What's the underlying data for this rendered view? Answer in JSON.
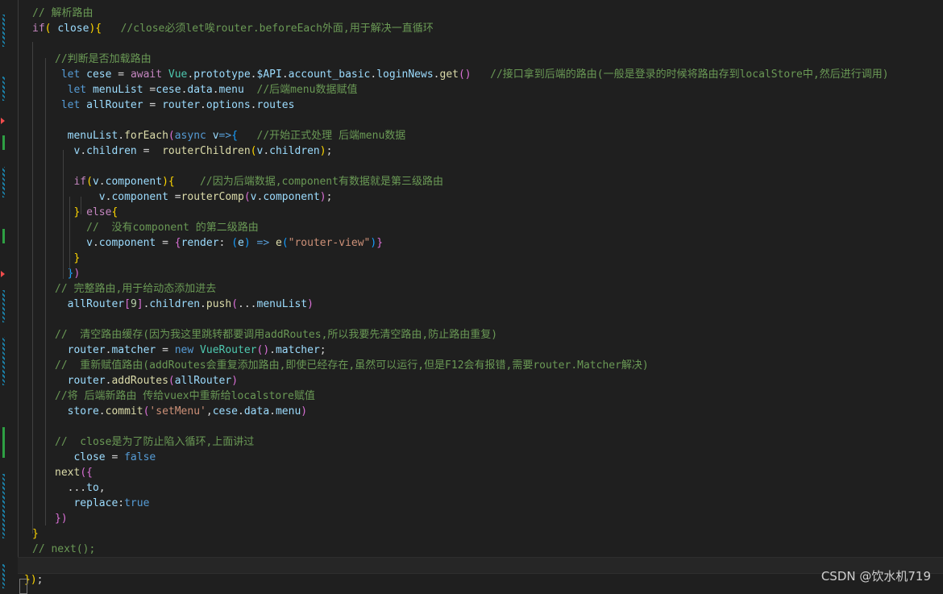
{
  "code_lines": [
    {
      "t": 0,
      "s": [
        [
          "// 解析路由",
          "t-cm"
        ]
      ]
    },
    {
      "t": 0,
      "s": [
        [
          "if",
          "t-ctl"
        ],
        [
          "( ",
          "t-br1"
        ],
        [
          "close",
          "t-var"
        ],
        [
          "){",
          "t-br1"
        ],
        [
          "   //close必须let唉router.beforeEach外面,用于解决一直循环",
          "t-cm"
        ]
      ]
    },
    {
      "t": 0,
      "s": []
    },
    {
      "t": 1,
      "s": [
        [
          "//判断是否加载路由",
          "t-cm"
        ]
      ]
    },
    {
      "t": 1,
      "s": [
        [
          " ",
          "t-pl"
        ],
        [
          "let ",
          "t-kw"
        ],
        [
          "cese",
          "t-var"
        ],
        [
          " = ",
          "t-pl"
        ],
        [
          "await ",
          "t-ctl"
        ],
        [
          "Vue",
          "t-cls"
        ],
        [
          ".",
          "t-pl"
        ],
        [
          "prototype",
          "t-var"
        ],
        [
          ".",
          "t-pl"
        ],
        [
          "$API",
          "t-var"
        ],
        [
          ".",
          "t-pl"
        ],
        [
          "account_basic",
          "t-var"
        ],
        [
          ".",
          "t-pl"
        ],
        [
          "loginNews",
          "t-var"
        ],
        [
          ".",
          "t-pl"
        ],
        [
          "get",
          "t-fn"
        ],
        [
          "()",
          "t-br2"
        ],
        [
          "   //接口拿到后端的路由(一般是登录的时候将路由存到localStore中,然后进行调用)",
          "t-cm"
        ]
      ]
    },
    {
      "t": 1,
      "s": [
        [
          "  let ",
          "t-kw"
        ],
        [
          "menuList",
          "t-var"
        ],
        [
          " =",
          "t-pl"
        ],
        [
          "cese",
          "t-var"
        ],
        [
          ".",
          "t-pl"
        ],
        [
          "data",
          "t-var"
        ],
        [
          ".",
          "t-pl"
        ],
        [
          "menu",
          "t-var"
        ],
        [
          "  //后端menu数据赋值",
          "t-cm"
        ]
      ]
    },
    {
      "t": 1,
      "s": [
        [
          " let ",
          "t-kw"
        ],
        [
          "allRouter",
          "t-var"
        ],
        [
          " = ",
          "t-pl"
        ],
        [
          "router",
          "t-var"
        ],
        [
          ".",
          "t-pl"
        ],
        [
          "options",
          "t-var"
        ],
        [
          ".",
          "t-pl"
        ],
        [
          "routes",
          "t-var"
        ]
      ]
    },
    {
      "t": 1,
      "s": []
    },
    {
      "t": 1,
      "s": [
        [
          "  ",
          "t-pl"
        ],
        [
          "menuList",
          "t-var"
        ],
        [
          ".",
          "t-pl"
        ],
        [
          "forEach",
          "t-fn"
        ],
        [
          "(",
          "t-br2"
        ],
        [
          "async ",
          "t-kw"
        ],
        [
          "v",
          "t-var"
        ],
        [
          "=>",
          "t-kw"
        ],
        [
          "{",
          "t-br3"
        ],
        [
          "   //开始正式处理 后端menu数据",
          "t-cm"
        ]
      ]
    },
    {
      "t": 1,
      "s": [
        [
          "   ",
          "t-pl"
        ],
        [
          "v",
          "t-var"
        ],
        [
          ".",
          "t-pl"
        ],
        [
          "children",
          "t-var"
        ],
        [
          " =  ",
          "t-pl"
        ],
        [
          "routerChildren",
          "t-fn"
        ],
        [
          "(",
          "t-br1"
        ],
        [
          "v",
          "t-var"
        ],
        [
          ".",
          "t-pl"
        ],
        [
          "children",
          "t-var"
        ],
        [
          ")",
          "t-br1"
        ],
        [
          ";",
          "t-pl"
        ]
      ]
    },
    {
      "t": 1,
      "s": []
    },
    {
      "t": 1,
      "s": [
        [
          "   ",
          "t-pl"
        ],
        [
          "if",
          "t-ctl"
        ],
        [
          "(",
          "t-br1"
        ],
        [
          "v",
          "t-var"
        ],
        [
          ".",
          "t-pl"
        ],
        [
          "component",
          "t-var"
        ],
        [
          "){",
          "t-br1"
        ],
        [
          "    //因为后端数据,component有数据就是第三级路由",
          "t-cm"
        ]
      ]
    },
    {
      "t": 1,
      "s": [
        [
          "       ",
          "t-pl"
        ],
        [
          "v",
          "t-var"
        ],
        [
          ".",
          "t-pl"
        ],
        [
          "component",
          "t-var"
        ],
        [
          " =",
          "t-pl"
        ],
        [
          "routerComp",
          "t-fn"
        ],
        [
          "(",
          "t-br2"
        ],
        [
          "v",
          "t-var"
        ],
        [
          ".",
          "t-pl"
        ],
        [
          "component",
          "t-var"
        ],
        [
          ")",
          "t-br2"
        ],
        [
          ";",
          "t-pl"
        ]
      ]
    },
    {
      "t": 1,
      "s": [
        [
          "   ",
          "t-pl"
        ],
        [
          "}",
          "t-br1"
        ],
        [
          " else",
          "t-ctl"
        ],
        [
          "{",
          "t-br1"
        ]
      ]
    },
    {
      "t": 1,
      "s": [
        [
          "     //  没有component 的第二级路由",
          "t-cm"
        ]
      ]
    },
    {
      "t": 1,
      "s": [
        [
          "     ",
          "t-pl"
        ],
        [
          "v",
          "t-var"
        ],
        [
          ".",
          "t-pl"
        ],
        [
          "component",
          "t-var"
        ],
        [
          " = ",
          "t-pl"
        ],
        [
          "{",
          "t-br2"
        ],
        [
          "render",
          "t-var"
        ],
        [
          ": ",
          "t-pl"
        ],
        [
          "(",
          "t-br3"
        ],
        [
          "e",
          "t-var"
        ],
        [
          ")",
          "t-br3"
        ],
        [
          " => ",
          "t-kw"
        ],
        [
          "e",
          "t-fn"
        ],
        [
          "(",
          "t-br3"
        ],
        [
          "\"router-view\"",
          "t-str"
        ],
        [
          ")",
          "t-br3"
        ],
        [
          "}",
          "t-br2"
        ]
      ]
    },
    {
      "t": 1,
      "s": [
        [
          "   ",
          "t-pl"
        ],
        [
          "}",
          "t-br1"
        ]
      ]
    },
    {
      "t": 1,
      "s": [
        [
          "  ",
          "t-pl"
        ],
        [
          "}",
          "t-br3"
        ],
        [
          ")",
          "t-br2"
        ]
      ]
    },
    {
      "t": 1,
      "s": [
        [
          "// 完整路由,用于给动态添加进去",
          "t-cm"
        ]
      ]
    },
    {
      "t": 1,
      "s": [
        [
          "  ",
          "t-pl"
        ],
        [
          "allRouter",
          "t-var"
        ],
        [
          "[",
          "t-br2"
        ],
        [
          "9",
          "t-num"
        ],
        [
          "]",
          "t-br2"
        ],
        [
          ".",
          "t-pl"
        ],
        [
          "children",
          "t-var"
        ],
        [
          ".",
          "t-pl"
        ],
        [
          "push",
          "t-fn"
        ],
        [
          "(",
          "t-br2"
        ],
        [
          "...",
          "t-pl"
        ],
        [
          "menuList",
          "t-var"
        ],
        [
          ")",
          "t-br2"
        ]
      ]
    },
    {
      "t": 1,
      "s": []
    },
    {
      "t": 1,
      "s": [
        [
          "//  清空路由缓存(因为我这里跳转都要调用addRoutes,所以我要先清空路由,防止路由重复)",
          "t-cm"
        ]
      ]
    },
    {
      "t": 1,
      "s": [
        [
          "  ",
          "t-pl"
        ],
        [
          "router",
          "t-var"
        ],
        [
          ".",
          "t-pl"
        ],
        [
          "matcher",
          "t-var"
        ],
        [
          " = ",
          "t-pl"
        ],
        [
          "new ",
          "t-kw"
        ],
        [
          "VueRouter",
          "t-cls"
        ],
        [
          "()",
          "t-br2"
        ],
        [
          ".",
          "t-pl"
        ],
        [
          "matcher",
          "t-var"
        ],
        [
          ";",
          "t-pl"
        ]
      ]
    },
    {
      "t": 1,
      "s": [
        [
          "//  重新赋值路由(addRoutes会重复添加路由,即使已经存在,虽然可以运行,但是F12会有报错,需要router.Matcher解决)",
          "t-cm"
        ]
      ]
    },
    {
      "t": 1,
      "s": [
        [
          "  ",
          "t-pl"
        ],
        [
          "router",
          "t-var"
        ],
        [
          ".",
          "t-pl"
        ],
        [
          "addRoutes",
          "t-fn"
        ],
        [
          "(",
          "t-br2"
        ],
        [
          "allRouter",
          "t-var"
        ],
        [
          ")",
          "t-br2"
        ]
      ]
    },
    {
      "t": 1,
      "s": [
        [
          "//将 后端新路由 传给vuex中重新给localstore赋值",
          "t-cm"
        ]
      ]
    },
    {
      "t": 1,
      "s": [
        [
          "  ",
          "t-pl"
        ],
        [
          "store",
          "t-var"
        ],
        [
          ".",
          "t-pl"
        ],
        [
          "commit",
          "t-fn"
        ],
        [
          "(",
          "t-br2"
        ],
        [
          "'setMenu'",
          "t-str"
        ],
        [
          ",",
          "t-pl"
        ],
        [
          "cese",
          "t-var"
        ],
        [
          ".",
          "t-pl"
        ],
        [
          "data",
          "t-var"
        ],
        [
          ".",
          "t-pl"
        ],
        [
          "menu",
          "t-var"
        ],
        [
          ")",
          "t-br2"
        ]
      ]
    },
    {
      "t": 1,
      "s": []
    },
    {
      "t": 1,
      "s": [
        [
          "//  close是为了防止陷入循环,上面讲过",
          "t-cm"
        ]
      ]
    },
    {
      "t": 1,
      "s": [
        [
          "   ",
          "t-pl"
        ],
        [
          "close",
          "t-var"
        ],
        [
          " = ",
          "t-pl"
        ],
        [
          "false",
          "t-kw"
        ]
      ]
    },
    {
      "t": 1,
      "s": [
        [
          "next",
          "t-fn"
        ],
        [
          "({",
          "t-br2"
        ]
      ]
    },
    {
      "t": 1,
      "s": [
        [
          "  ...",
          "t-pl"
        ],
        [
          "to",
          "t-var"
        ],
        [
          ",",
          "t-pl"
        ]
      ]
    },
    {
      "t": 1,
      "s": [
        [
          "   ",
          "t-pl"
        ],
        [
          "replace",
          "t-var"
        ],
        [
          ":",
          "t-pl"
        ],
        [
          "true",
          "t-kw"
        ]
      ]
    },
    {
      "t": 1,
      "s": [
        [
          "})",
          "t-br2"
        ]
      ]
    },
    {
      "t": 0,
      "s": [
        [
          "}",
          "t-br1"
        ]
      ]
    },
    {
      "t": 0,
      "s": [
        [
          "// next();",
          "t-cm"
        ]
      ]
    },
    {
      "t": 0,
      "s": []
    },
    {
      "t": -1,
      "s": [
        [
          "})",
          "t-br1"
        ],
        [
          ";",
          "t-pl"
        ]
      ]
    }
  ],
  "watermark": "CSDN @饮水机719"
}
